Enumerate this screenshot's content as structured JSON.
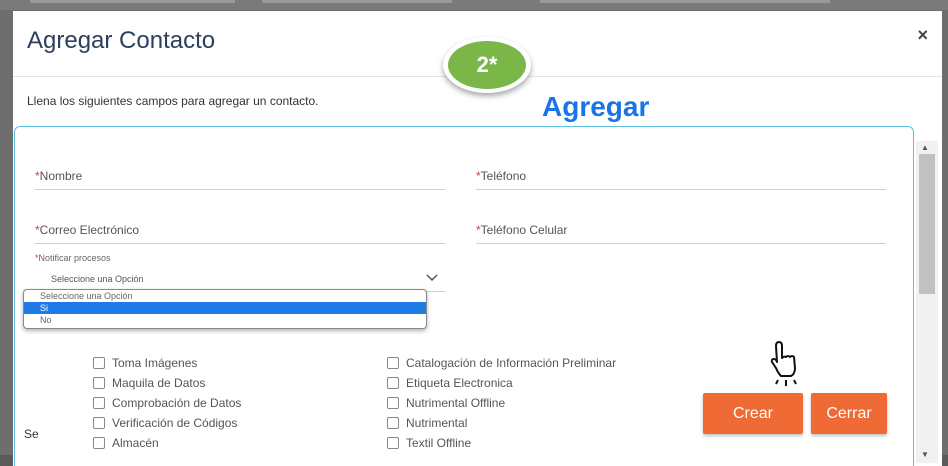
{
  "modal": {
    "title": "Agregar Contacto",
    "close_symbol": "×",
    "step_badge": "2*",
    "instructions": "Llena los siguientes campos para agregar un contacto.",
    "annotation": "Agregar"
  },
  "form": {
    "required_mark": "*",
    "fields": {
      "nombre": "Nombre",
      "telefono": "Teléfono",
      "correo": "Correo Electrónico",
      "celular": "Teléfono Celular"
    },
    "notificar": {
      "label": "Notificar procesos",
      "selected_value": "Seleccione una Opción",
      "options": [
        "Seleccione una Opción",
        "Si",
        "No"
      ],
      "highlighted_option": "Si"
    },
    "section_label_truncated": "Se",
    "checkboxes_left": [
      "Toma Imágenes",
      "Maquila de Datos",
      "Comprobación de Datos",
      "Verificación de Códigos",
      "Almacén"
    ],
    "checkboxes_right": [
      "Catalogación de Información Preliminar",
      "Etiqueta Electronica",
      "Nutrimental Offline",
      "Nutrimental",
      "Textil Offline"
    ]
  },
  "buttons": {
    "crear": "Crear",
    "cerrar": "Cerrar"
  },
  "colors": {
    "accent_button": "#ef6a35",
    "badge_green": "#7ab648",
    "annotation_blue": "#1a73e8",
    "form_border": "#5bc0de",
    "selected_option": "#1e7be6"
  },
  "icons": {
    "pointer": "hand-pointer-icon",
    "chevron": "chevron-down-icon",
    "close": "close-icon"
  }
}
